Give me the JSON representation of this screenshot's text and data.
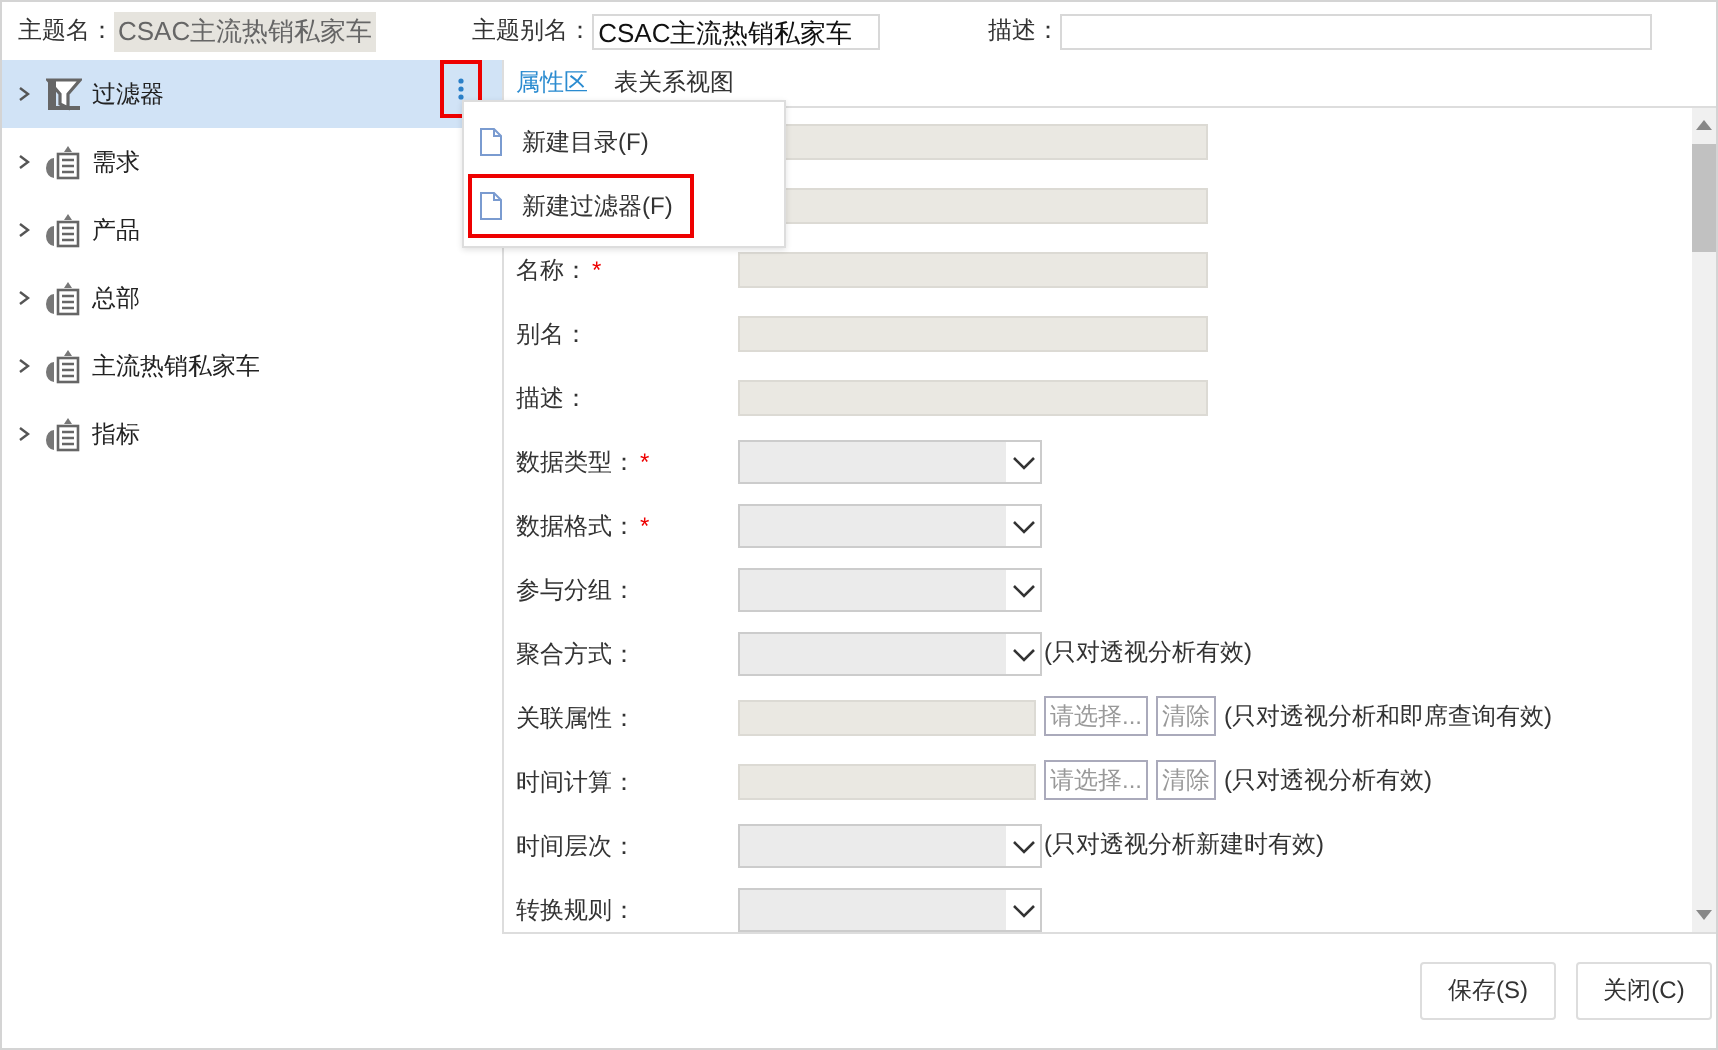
{
  "header": {
    "fields": [
      {
        "label": "主题名：",
        "value": "CSAC主流热销私家车",
        "kind": "readonly"
      },
      {
        "label": "主题别名：",
        "value": "CSAC主流热销私家车",
        "kind": "input"
      },
      {
        "label": "描述：",
        "kind": "wide"
      }
    ]
  },
  "tree": {
    "items": [
      {
        "label": "过滤器",
        "kind": "filter",
        "selected": true,
        "expanded": false
      },
      {
        "label": "需求",
        "kind": "table",
        "selected": false,
        "expanded": false
      },
      {
        "label": "产品",
        "kind": "table",
        "selected": false,
        "expanded": false
      },
      {
        "label": "总部",
        "kind": "table",
        "selected": false,
        "expanded": false
      },
      {
        "label": "主流热销私家车",
        "kind": "table",
        "selected": false,
        "expanded": false
      },
      {
        "label": "指标",
        "kind": "table",
        "selected": false,
        "expanded": false
      }
    ],
    "more_button": {
      "highlighted": true
    }
  },
  "context_menu": {
    "items": [
      {
        "label": "新建目录(F)",
        "highlighted": false
      },
      {
        "label": "新建过滤器(F)",
        "highlighted": true
      }
    ]
  },
  "tabs": [
    {
      "label": "属性区",
      "selected": true
    },
    {
      "label": "表关系视图",
      "selected": false
    }
  ],
  "form": {
    "rows": [
      {
        "kind": "text"
      },
      {
        "kind": "text"
      },
      {
        "label": "名称：",
        "required_mark": "*",
        "kind": "text"
      },
      {
        "label": "别名：",
        "kind": "text"
      },
      {
        "label": "描述：",
        "kind": "text"
      },
      {
        "label": "数据类型：",
        "required_mark": "*",
        "kind": "select"
      },
      {
        "label": "数据格式：",
        "required_mark": "*",
        "kind": "select"
      },
      {
        "label": "参与分组：",
        "kind": "select"
      },
      {
        "label": "聚合方式：",
        "kind": "select",
        "note": "(只对透视分析有效)"
      },
      {
        "label": "关联属性：",
        "kind": "picker",
        "pick": "请选择...",
        "clear": "清除",
        "note": "(只对透视分析和即席查询有效)"
      },
      {
        "label": "时间计算：",
        "kind": "picker",
        "pick": "请选择...",
        "clear": "清除",
        "note": "(只对透视分析有效)"
      },
      {
        "label": "时间层次：",
        "kind": "select",
        "note": "(只对透视分析新建时有效)"
      },
      {
        "label": "转换规则：",
        "kind": "select"
      }
    ]
  },
  "buttons": [
    {
      "label": "保存(S)"
    },
    {
      "label": "关闭(C)"
    }
  ]
}
